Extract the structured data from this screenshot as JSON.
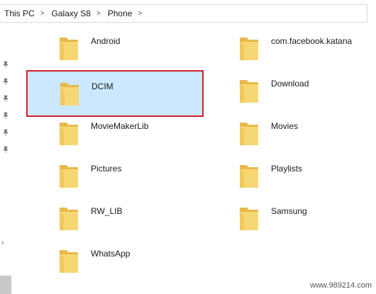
{
  "breadcrumb": {
    "items": [
      "This PC",
      "Galaxy S8",
      "Phone"
    ],
    "separator": ">"
  },
  "folders": {
    "left": [
      {
        "name": "Android",
        "selected": false
      },
      {
        "name": "DCIM",
        "selected": true
      },
      {
        "name": "MovieMakerLib",
        "selected": false
      },
      {
        "name": "Pictures",
        "selected": false
      },
      {
        "name": "RW_LIB",
        "selected": false
      },
      {
        "name": "WhatsApp",
        "selected": false
      }
    ],
    "right": [
      {
        "name": "com.facebook.katana",
        "selected": false
      },
      {
        "name": "Download",
        "selected": false
      },
      {
        "name": "Movies",
        "selected": false
      },
      {
        "name": "Playlists",
        "selected": false
      },
      {
        "name": "Samsung",
        "selected": false
      }
    ]
  },
  "colors": {
    "selection_bg": "#cce8ff",
    "highlight_border": "#d0202a",
    "folder_body": "#f7d774",
    "folder_tab": "#e8b94a"
  },
  "watermark": "www.989214.com"
}
